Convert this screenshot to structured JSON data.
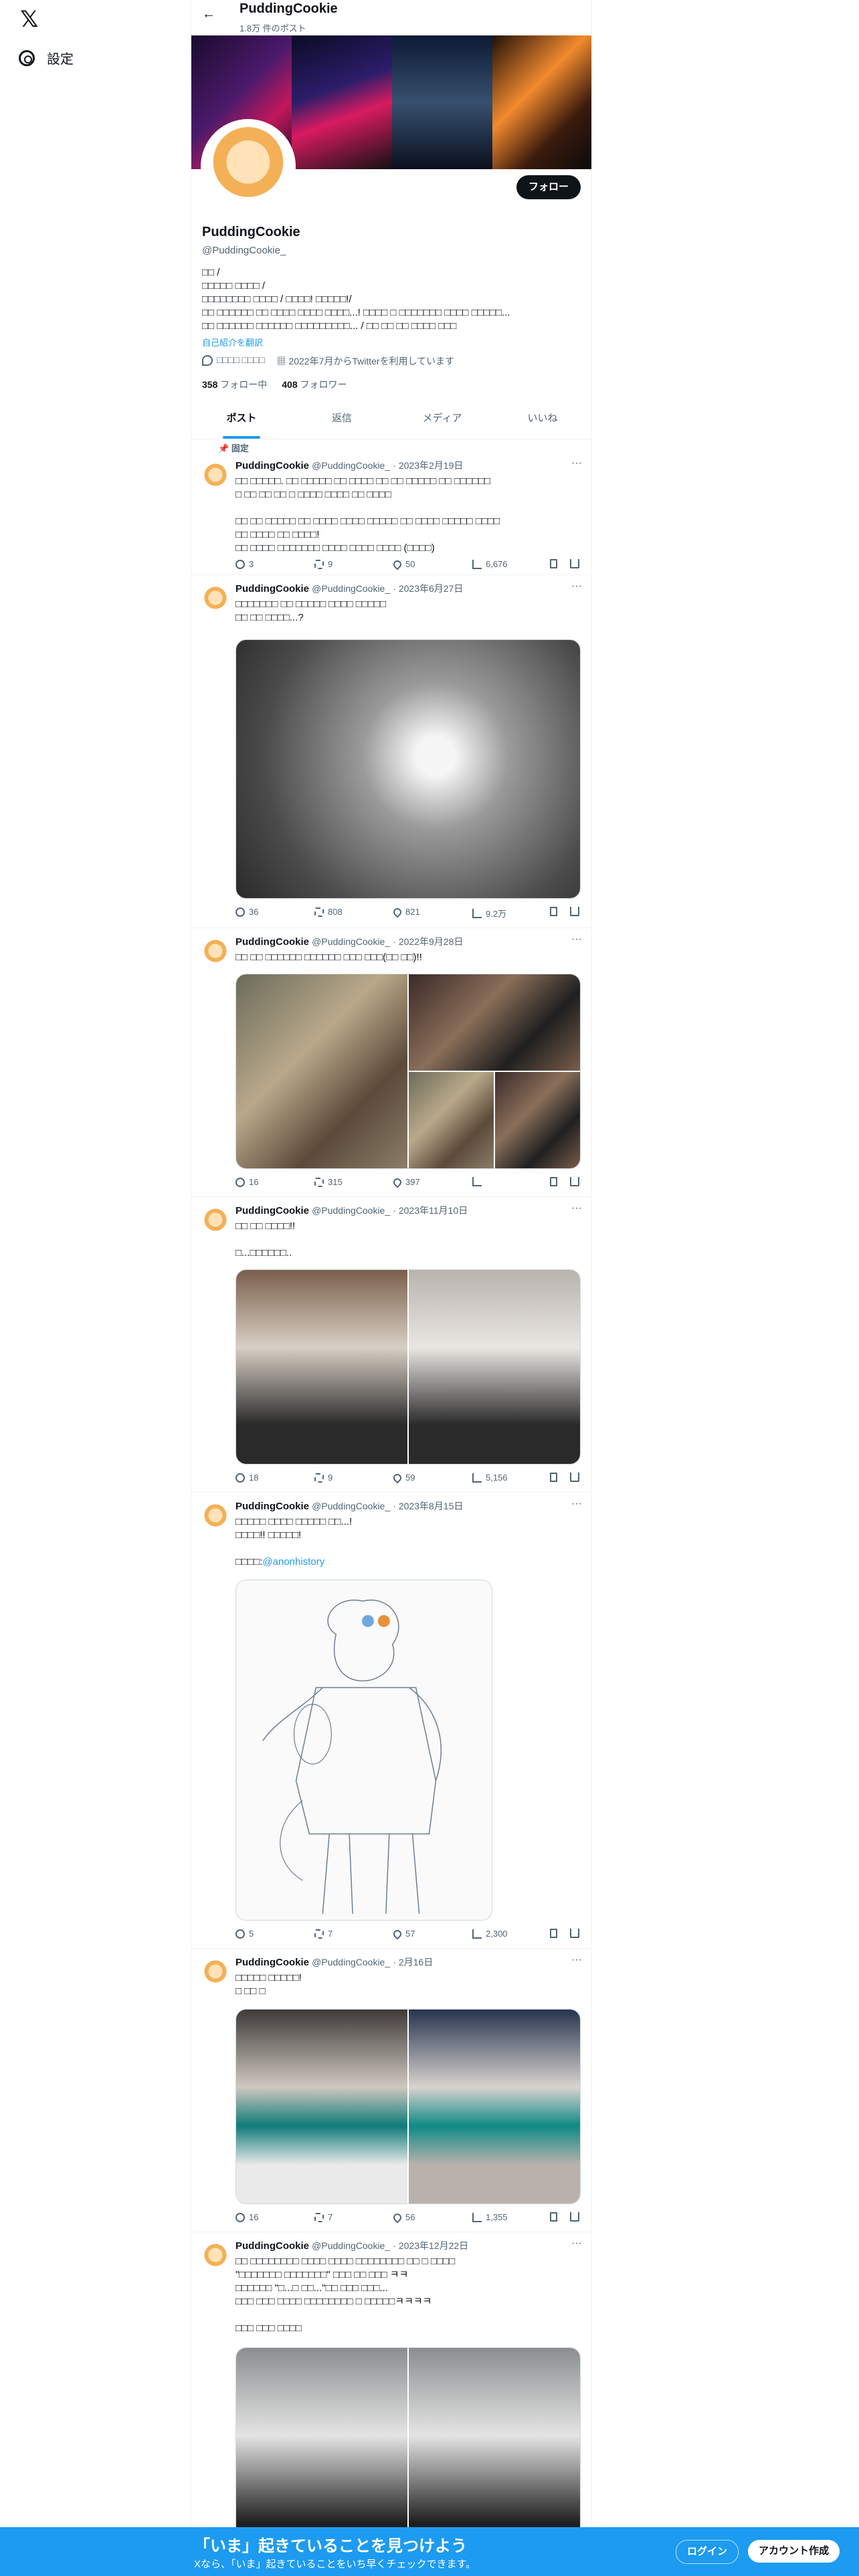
{
  "nav": {
    "logo": "𝕏",
    "settings_label": "設定"
  },
  "header": {
    "name": "PuddingCookie",
    "post_count": "1.8万 件のポスト"
  },
  "profile": {
    "display_name": "PuddingCookie",
    "handle": "@PuddingCookie_",
    "follow_label": "フォロー",
    "bio_line1": "□□ /",
    "bio_line2": "□□□□□ □□□□ /",
    "bio_line3": "□□□□□□□□ □□□□ / □□□□! □□□□□!/",
    "bio_line4": "□□ □□□□□□ □□ □□□□ □□□□ □□□□...! □□□□ □ □□□□□□□ □□□□ □□□□□...",
    "bio_line5": "□□ □□□□□□ □□□□□□ □□□□□□□□□... / □□ □□ □□ □□□□ □□□",
    "translate": "自己紹介を翻訳",
    "location": "□□□□ □□□□",
    "joined": "2022年7月からTwitterを利用しています",
    "following_count": "358",
    "following_label": "フォロー中",
    "followers_count": "408",
    "followers_label": "フォロワー"
  },
  "tabs": [
    {
      "label": "ポスト"
    },
    {
      "label": "返信"
    },
    {
      "label": "メディア"
    },
    {
      "label": "いいね"
    }
  ],
  "pinned_label": "固定",
  "posts": [
    {
      "name": "PuddingCookie",
      "handle": "@PuddingCookie_",
      "date": "· 2023年2月19日",
      "text": "□□ □□□□□. □□ □□□□□ □□ □□□□ □□ □□ □□□□□ □□ □□□□□□\n□ □□ □□ □□ □ □□□□ □□□□ □□ □□□□\n\n□□ □□ □□□□□ □□ □□□□ □□□□ □□□□□ □□ □□□□ □□□□□ □□□□\n□□ □□□□ □□ □□□□!\n□□ □□□□ □□□□□□□ □□□□ □□□□ □□□□ (□□□□)",
      "reply": "3",
      "repost": "9",
      "like": "50",
      "views": "6,676"
    },
    {
      "name": "PuddingCookie",
      "handle": "@PuddingCookie_",
      "date": "· 2023年6月27日",
      "text": "□□□□□□□ □□ □□□□□ □□□□ □□□□□\n□□ □□ □□□□...?",
      "reply": "36",
      "repost": "808",
      "like": "821",
      "views": "9.2万"
    },
    {
      "name": "PuddingCookie",
      "handle": "@PuddingCookie_",
      "date": "· 2022年9月28日",
      "text": "□□ □□ □□□□□□ □□□□□□ □□□ □□□(□□ □□)!!",
      "reply": "16",
      "repost": "315",
      "like": "397",
      "views": ""
    },
    {
      "name": "PuddingCookie",
      "handle": "@PuddingCookie_",
      "date": "· 2023年11月10日",
      "text": "□□ □□ □□□□!!\n\n□...□□□□□□..",
      "reply": "18",
      "repost": "9",
      "like": "59",
      "views": "5,156"
    },
    {
      "name": "PuddingCookie",
      "handle": "@PuddingCookie_",
      "date": "· 2023年8月15日",
      "text": "□□□□□ □□□□ □□□□□ □□...!\n□□□□!! □□□□□!\n\n",
      "credit_prefix": "□□□□:",
      "credit_link": "@anonhistory",
      "reply": "5",
      "repost": "7",
      "like": "57",
      "views": "2,300"
    },
    {
      "name": "PuddingCookie",
      "handle": "@PuddingCookie_",
      "date": "· 2月16日",
      "text": "□□□□□ □□□□□!\n□ □□ □",
      "reply": "16",
      "repost": "7",
      "like": "56",
      "views": "1,355"
    },
    {
      "name": "PuddingCookie",
      "handle": "@PuddingCookie_",
      "date": "· 2023年12月22日",
      "text": "□□ □□□□□□□□ □□□□ □□□□ □□□□□□□□ □□ □ □□□□\n\"□□□□□□□ □□□□□□□\" □□□ □□ □□□ ㅋㅋ\n□□□□□□ \"□...□ □□...\"□□ □□□ □□□...\n□□□ □□□ □□□□ □□□□□□□□ □ □□□□□ㅋㅋㅋㅋ\n\n□□□ □□□ □□□□",
      "reply": "",
      "repost": "",
      "like": "",
      "views": ""
    }
  ],
  "banner": {
    "title": "「いま」起きていることを見つけよう",
    "subtitle": "Xなら、「いま」起きていることをいち早くチェックできます。",
    "login": "ログイン",
    "signup": "アカウント作成"
  }
}
